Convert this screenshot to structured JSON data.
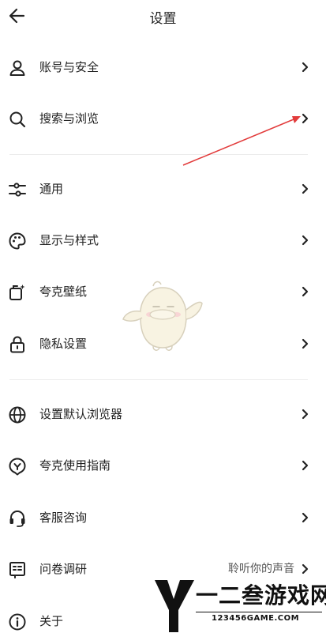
{
  "header": {
    "title": "设置"
  },
  "sections": [
    {
      "items": [
        {
          "icon": "person-icon",
          "label": "账号与安全"
        },
        {
          "icon": "search-icon",
          "label": "搜索与浏览"
        }
      ]
    },
    {
      "items": [
        {
          "icon": "sliders-icon",
          "label": "通用"
        },
        {
          "icon": "palette-icon",
          "label": "显示与样式"
        },
        {
          "icon": "wallpaper-icon",
          "label": "夸克壁纸"
        },
        {
          "icon": "lock-icon",
          "label": "隐私设置"
        }
      ]
    },
    {
      "items": [
        {
          "icon": "globe-icon",
          "label": "设置默认浏览器"
        },
        {
          "icon": "guide-bubble-icon",
          "label": "夸克使用指南"
        },
        {
          "icon": "headset-icon",
          "label": "客服咨询"
        },
        {
          "icon": "survey-icon",
          "label": "问卷调研",
          "value": "聆听你的声音"
        },
        {
          "icon": "info-icon",
          "label": "关于"
        }
      ]
    }
  ],
  "watermark": {
    "main": "一二叁游戏网",
    "url": "123456GAME.COM"
  },
  "colors": {
    "text": "#222222",
    "secondary": "#555555",
    "divider": "#ececec",
    "annotation_arrow": "#e23b3b",
    "background": "#ffffff"
  }
}
